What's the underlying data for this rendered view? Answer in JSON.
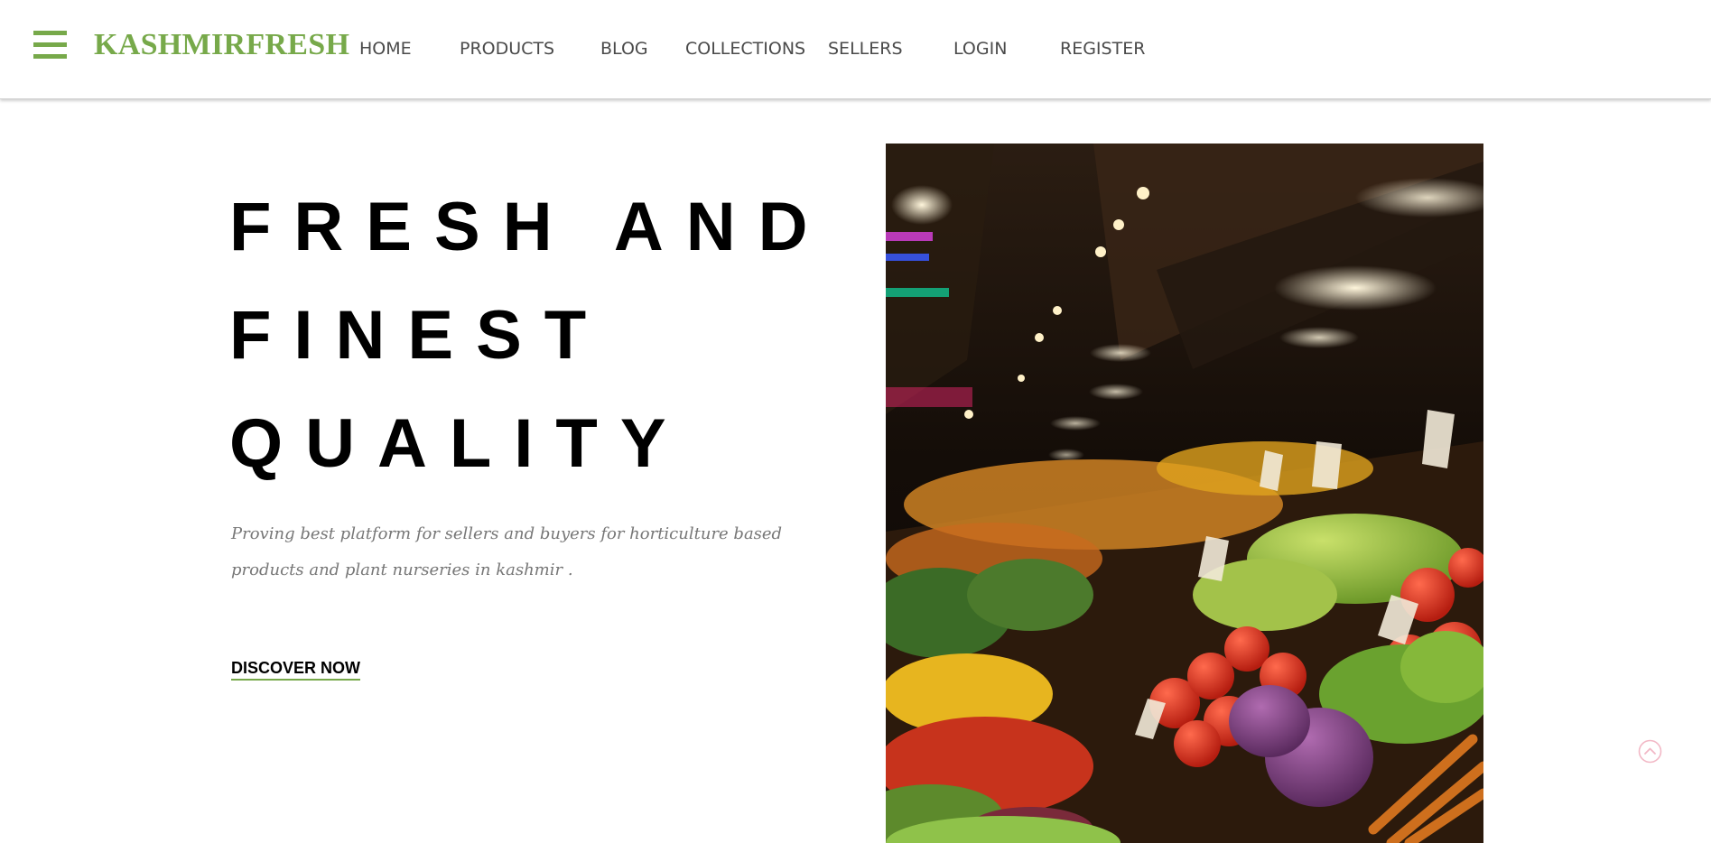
{
  "header": {
    "logo": "KASHMIRFRESH",
    "brand_color": "#77a94a",
    "menu_icon": "hamburger-menu-icon",
    "nav": [
      {
        "label": "HOME"
      },
      {
        "label": "PRODUCTS"
      },
      {
        "label": "BLOG"
      },
      {
        "label": "COLLECTIONS"
      },
      {
        "label": "SELLERS"
      },
      {
        "label": "LOGIN"
      },
      {
        "label": "REGISTER"
      }
    ]
  },
  "hero": {
    "title_lines": [
      "FRESH AND",
      "FINEST",
      "QUALITY"
    ],
    "subtitle": "Proving best platform for sellers and buyers for horticulture based products and plant nurseries in kashmir .",
    "cta_label": "DISCOVER NOW",
    "image_icon": "market-produce-photo"
  },
  "scroll_top": {
    "icon": "chevron-up-circle-icon",
    "color": "#f2b8c6"
  }
}
